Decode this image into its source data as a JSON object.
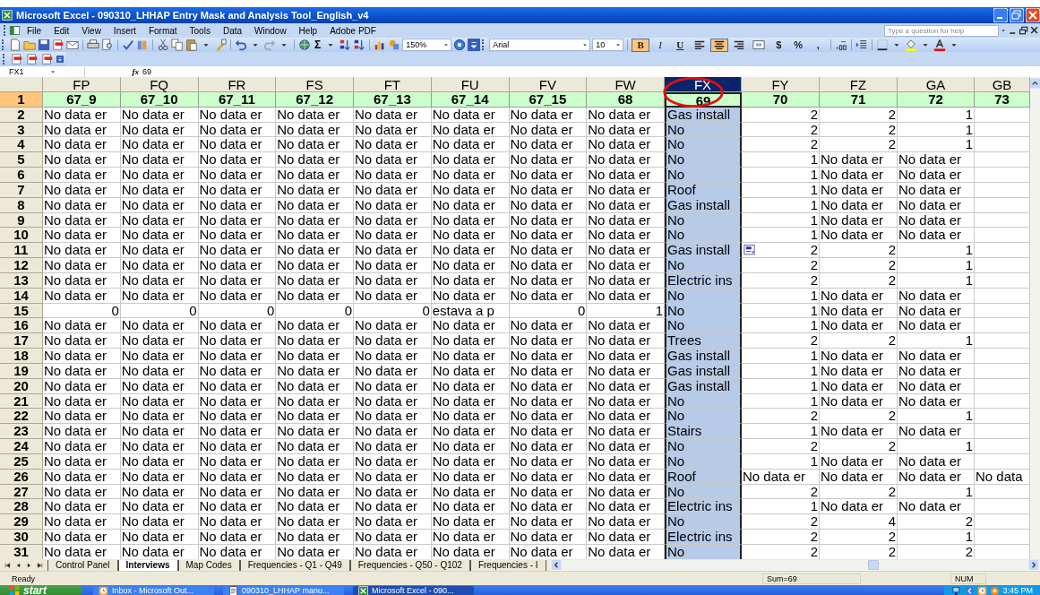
{
  "window": {
    "title": "Microsoft Excel - 090310_LHHAP Entry Mask and Analysis Tool_English_v4"
  },
  "menu": [
    "File",
    "Edit",
    "View",
    "Insert",
    "Format",
    "Tools",
    "Data",
    "Window",
    "Help",
    "Adobe PDF"
  ],
  "help_box": {
    "placeholder": "Type a question for help"
  },
  "autosum": "Σ",
  "zoom": "150%",
  "font": {
    "name": "Arial",
    "size": "10"
  },
  "format_buttons": [
    {
      "kind": "bold",
      "label": "B",
      "on": true
    },
    {
      "kind": "italic",
      "label": "I",
      "on": false
    },
    {
      "kind": "underline",
      "label": "U",
      "on": false
    },
    {
      "kind": "align-left",
      "on": false
    },
    {
      "kind": "align-center",
      "on": true
    },
    {
      "kind": "align-right",
      "on": false
    },
    {
      "kind": "merge",
      "on": false
    },
    {
      "kind": "plain",
      "label": "$",
      "on": false
    },
    {
      "kind": "plain",
      "label": "%",
      "on": false
    },
    {
      "kind": "plain",
      "label": ",",
      "on": false
    }
  ],
  "name_box": "FX1",
  "function_label": "fx",
  "formula": "69",
  "columns": [
    {
      "label": "FP",
      "selected": false,
      "circled": false
    },
    {
      "label": "FQ",
      "selected": false,
      "circled": false
    },
    {
      "label": "FR",
      "selected": false,
      "circled": false
    },
    {
      "label": "FS",
      "selected": false,
      "circled": false
    },
    {
      "label": "FT",
      "selected": false,
      "circled": false
    },
    {
      "label": "FU",
      "selected": false,
      "circled": false
    },
    {
      "label": "FV",
      "selected": false,
      "circled": false
    },
    {
      "label": "FW",
      "selected": false,
      "circled": false
    },
    {
      "label": "FX",
      "selected": true,
      "circled": true
    },
    {
      "label": "FY",
      "selected": false,
      "circled": false
    },
    {
      "label": "FZ",
      "selected": false,
      "circled": false
    },
    {
      "label": "GA",
      "selected": false,
      "circled": false
    },
    {
      "label": "GB",
      "selected": false,
      "circled": false
    }
  ],
  "rows": [
    {
      "number": "1",
      "kind": "heading",
      "selected": true,
      "smart_tag": false,
      "cells": [
        "67_9",
        "67_10",
        "67_11",
        "67_12",
        "67_13",
        "67_14",
        "67_15",
        "68",
        "69",
        "70",
        "71",
        "72",
        "73"
      ]
    },
    {
      "number": "2",
      "kind": "data",
      "selected": false,
      "smart_tag": false,
      "cells": [
        "No data er",
        "No data er",
        "No data er",
        "No data er",
        "No data er",
        "No data er",
        "No data er",
        "No data er",
        "Gas install",
        "2",
        "2",
        "1"
      ]
    },
    {
      "number": "3",
      "kind": "data",
      "selected": false,
      "smart_tag": false,
      "cells": [
        "No data er",
        "No data er",
        "No data er",
        "No data er",
        "No data er",
        "No data er",
        "No data er",
        "No data er",
        "No",
        "2",
        "2",
        "1"
      ]
    },
    {
      "number": "4",
      "kind": "data",
      "selected": false,
      "smart_tag": false,
      "cells": [
        "No data er",
        "No data er",
        "No data er",
        "No data er",
        "No data er",
        "No data er",
        "No data er",
        "No data er",
        "No",
        "2",
        "2",
        "1"
      ]
    },
    {
      "number": "5",
      "kind": "data",
      "selected": false,
      "smart_tag": false,
      "cells": [
        "No data er",
        "No data er",
        "No data er",
        "No data er",
        "No data er",
        "No data er",
        "No data er",
        "No data er",
        "No",
        "1",
        "No data er",
        "No data er"
      ]
    },
    {
      "number": "6",
      "kind": "data",
      "selected": false,
      "smart_tag": false,
      "cells": [
        "No data er",
        "No data er",
        "No data er",
        "No data er",
        "No data er",
        "No data er",
        "No data er",
        "No data er",
        "No",
        "1",
        "No data er",
        "No data er"
      ]
    },
    {
      "number": "7",
      "kind": "data",
      "selected": false,
      "smart_tag": false,
      "cells": [
        "No data er",
        "No data er",
        "No data er",
        "No data er",
        "No data er",
        "No data er",
        "No data er",
        "No data er",
        "Roof",
        "1",
        "No data er",
        "No data er"
      ]
    },
    {
      "number": "8",
      "kind": "data",
      "selected": false,
      "smart_tag": false,
      "cells": [
        "No data er",
        "No data er",
        "No data er",
        "No data er",
        "No data er",
        "No data er",
        "No data er",
        "No data er",
        "Gas install",
        "1",
        "No data er",
        "No data er"
      ]
    },
    {
      "number": "9",
      "kind": "data",
      "selected": false,
      "smart_tag": false,
      "cells": [
        "No data er",
        "No data er",
        "No data er",
        "No data er",
        "No data er",
        "No data er",
        "No data er",
        "No data er",
        "No",
        "1",
        "No data er",
        "No data er"
      ]
    },
    {
      "number": "10",
      "kind": "data",
      "selected": false,
      "smart_tag": false,
      "cells": [
        "No data er",
        "No data er",
        "No data er",
        "No data er",
        "No data er",
        "No data er",
        "No data er",
        "No data er",
        "No",
        "1",
        "No data er",
        "No data er"
      ]
    },
    {
      "number": "11",
      "kind": "data",
      "selected": false,
      "smart_tag": true,
      "cells": [
        "No data er",
        "No data er",
        "No data er",
        "No data er",
        "No data er",
        "No data er",
        "No data er",
        "No data er",
        "Gas install",
        "2",
        "2",
        "1"
      ]
    },
    {
      "number": "12",
      "kind": "data",
      "selected": false,
      "smart_tag": false,
      "cells": [
        "No data er",
        "No data er",
        "No data er",
        "No data er",
        "No data er",
        "No data er",
        "No data er",
        "No data er",
        "No",
        "2",
        "2",
        "1"
      ]
    },
    {
      "number": "13",
      "kind": "data",
      "selected": false,
      "smart_tag": false,
      "cells": [
        "No data er",
        "No data er",
        "No data er",
        "No data er",
        "No data er",
        "No data er",
        "No data er",
        "No data er",
        "Electric ins",
        "2",
        "2",
        "1"
      ]
    },
    {
      "number": "14",
      "kind": "data",
      "selected": false,
      "smart_tag": false,
      "cells": [
        "No data er",
        "No data er",
        "No data er",
        "No data er",
        "No data er",
        "No data er",
        "No data er",
        "No data er",
        "No",
        "1",
        "No data er",
        "No data er"
      ]
    },
    {
      "number": "15",
      "kind": "data",
      "selected": false,
      "smart_tag": false,
      "cells": [
        "0",
        "0",
        "0",
        "0",
        "0",
        "estava a p",
        "0",
        "1",
        "No",
        "1",
        "No data er",
        "No data er"
      ]
    },
    {
      "number": "16",
      "kind": "data",
      "selected": false,
      "smart_tag": false,
      "cells": [
        "No data er",
        "No data er",
        "No data er",
        "No data er",
        "No data er",
        "No data er",
        "No data er",
        "No data er",
        "No",
        "1",
        "No data er",
        "No data er"
      ]
    },
    {
      "number": "17",
      "kind": "data",
      "selected": false,
      "smart_tag": false,
      "cells": [
        "No data er",
        "No data er",
        "No data er",
        "No data er",
        "No data er",
        "No data er",
        "No data er",
        "No data er",
        "Trees",
        "2",
        "2",
        "1"
      ]
    },
    {
      "number": "18",
      "kind": "data",
      "selected": false,
      "smart_tag": false,
      "cells": [
        "No data er",
        "No data er",
        "No data er",
        "No data er",
        "No data er",
        "No data er",
        "No data er",
        "No data er",
        "Gas install",
        "1",
        "No data er",
        "No data er"
      ]
    },
    {
      "number": "19",
      "kind": "data",
      "selected": false,
      "smart_tag": false,
      "cells": [
        "No data er",
        "No data er",
        "No data er",
        "No data er",
        "No data er",
        "No data er",
        "No data er",
        "No data er",
        "Gas install",
        "1",
        "No data er",
        "No data er"
      ]
    },
    {
      "number": "20",
      "kind": "data",
      "selected": false,
      "smart_tag": false,
      "cells": [
        "No data er",
        "No data er",
        "No data er",
        "No data er",
        "No data er",
        "No data er",
        "No data er",
        "No data er",
        "Gas install",
        "1",
        "No data er",
        "No data er"
      ]
    },
    {
      "number": "21",
      "kind": "data",
      "selected": false,
      "smart_tag": false,
      "cells": [
        "No data er",
        "No data er",
        "No data er",
        "No data er",
        "No data er",
        "No data er",
        "No data er",
        "No data er",
        "No",
        "1",
        "No data er",
        "No data er"
      ]
    },
    {
      "number": "22",
      "kind": "data",
      "selected": false,
      "smart_tag": false,
      "cells": [
        "No data er",
        "No data er",
        "No data er",
        "No data er",
        "No data er",
        "No data er",
        "No data er",
        "No data er",
        "No",
        "2",
        "2",
        "1"
      ]
    },
    {
      "number": "23",
      "kind": "data",
      "selected": false,
      "smart_tag": false,
      "cells": [
        "No data er",
        "No data er",
        "No data er",
        "No data er",
        "No data er",
        "No data er",
        "No data er",
        "No data er",
        "Stairs",
        "1",
        "No data er",
        "No data er"
      ]
    },
    {
      "number": "24",
      "kind": "data",
      "selected": false,
      "smart_tag": false,
      "cells": [
        "No data er",
        "No data er",
        "No data er",
        "No data er",
        "No data er",
        "No data er",
        "No data er",
        "No data er",
        "No",
        "2",
        "2",
        "1"
      ]
    },
    {
      "number": "25",
      "kind": "data",
      "selected": false,
      "smart_tag": false,
      "cells": [
        "No data er",
        "No data er",
        "No data er",
        "No data er",
        "No data er",
        "No data er",
        "No data er",
        "No data er",
        "No",
        "1",
        "No data er",
        "No data er"
      ]
    },
    {
      "number": "26",
      "kind": "data",
      "selected": false,
      "smart_tag": false,
      "cells": [
        "No data er",
        "No data er",
        "No data er",
        "No data er",
        "No data er",
        "No data er",
        "No data er",
        "No data er",
        "Roof",
        "No data er",
        "No data er",
        "No data er",
        "No data"
      ]
    },
    {
      "number": "27",
      "kind": "data",
      "selected": false,
      "smart_tag": false,
      "cells": [
        "No data er",
        "No data er",
        "No data er",
        "No data er",
        "No data er",
        "No data er",
        "No data er",
        "No data er",
        "No",
        "2",
        "2",
        "1"
      ]
    },
    {
      "number": "28",
      "kind": "data",
      "selected": false,
      "smart_tag": false,
      "cells": [
        "No data er",
        "No data er",
        "No data er",
        "No data er",
        "No data er",
        "No data er",
        "No data er",
        "No data er",
        "Electric ins",
        "1",
        "No data er",
        "No data er"
      ]
    },
    {
      "number": "29",
      "kind": "data",
      "selected": false,
      "smart_tag": false,
      "cells": [
        "No data er",
        "No data er",
        "No data er",
        "No data er",
        "No data er",
        "No data er",
        "No data er",
        "No data er",
        "No",
        "2",
        "4",
        "2"
      ]
    },
    {
      "number": "30",
      "kind": "data",
      "selected": false,
      "smart_tag": false,
      "cells": [
        "No data er",
        "No data er",
        "No data er",
        "No data er",
        "No data er",
        "No data er",
        "No data er",
        "No data er",
        "Electric ins",
        "2",
        "2",
        "1"
      ]
    },
    {
      "number": "31",
      "kind": "data",
      "selected": false,
      "smart_tag": false,
      "cells": [
        "No data er",
        "No data er",
        "No data er",
        "No data er",
        "No data er",
        "No data er",
        "No data er",
        "No data er",
        "No",
        "2",
        "2",
        "2"
      ]
    }
  ],
  "sheet_tabs": [
    {
      "label": "Control Panel",
      "selected": false
    },
    {
      "label": "Interviews",
      "selected": true
    },
    {
      "label": "Map Codes",
      "selected": false
    },
    {
      "label": "Frequencies - Q1 - Q49",
      "selected": false
    },
    {
      "label": "Frequencies - Q50 - Q102",
      "selected": false
    },
    {
      "label": "Frequencies - I",
      "selected": false
    }
  ],
  "status": {
    "text": "Ready",
    "sum": "Sum=69",
    "num": "NUM"
  },
  "taskbar": {
    "start": "start",
    "tasks": [
      {
        "label": "Inbox - Microsoft Out...",
        "selected": false
      },
      {
        "label": "090310_LHHAP manu...",
        "selected": false
      },
      {
        "label": "Microsoft Excel - 090...",
        "selected": true
      }
    ],
    "clock": "3:45 PM"
  }
}
